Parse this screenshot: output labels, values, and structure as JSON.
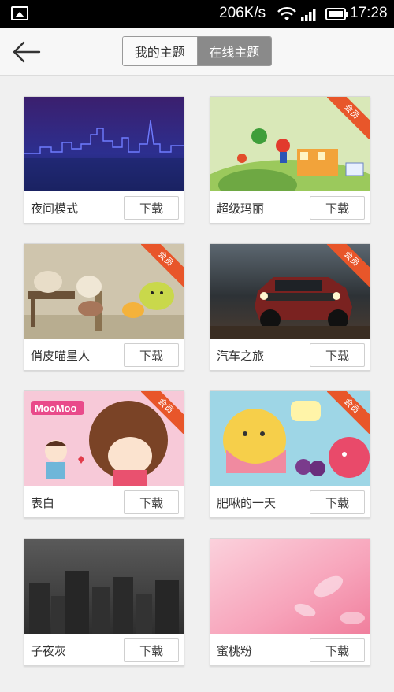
{
  "status_bar": {
    "speed": "206K/s",
    "time": "17:28",
    "icons": [
      "image-notification-icon",
      "wifi-icon",
      "signal-icon",
      "battery-icon"
    ]
  },
  "header": {
    "back_icon": "arrow-left-icon",
    "tabs": [
      {
        "label": "我的主题",
        "active": false
      },
      {
        "label": "在线主题",
        "active": true
      }
    ]
  },
  "themes": [
    {
      "name": "夜间模式",
      "download": "下载",
      "vip": false
    },
    {
      "name": "超级玛丽",
      "download": "下载",
      "vip": true,
      "vip_label": "会员"
    },
    {
      "name": "俏皮喵星人",
      "download": "下载",
      "vip": true,
      "vip_label": "会员"
    },
    {
      "name": "汽车之旅",
      "download": "下载",
      "vip": true,
      "vip_label": "会员"
    },
    {
      "name": "表白",
      "download": "下载",
      "vip": true,
      "vip_label": "会员"
    },
    {
      "name": "肥啾的一天",
      "download": "下载",
      "vip": true,
      "vip_label": "会员"
    },
    {
      "name": "子夜灰",
      "download": "下载",
      "vip": false
    },
    {
      "name": "蜜桃粉",
      "download": "下载",
      "vip": false
    }
  ],
  "colors": {
    "vip_ribbon": "#e8562a",
    "active_tab": "#8a8a8a"
  }
}
